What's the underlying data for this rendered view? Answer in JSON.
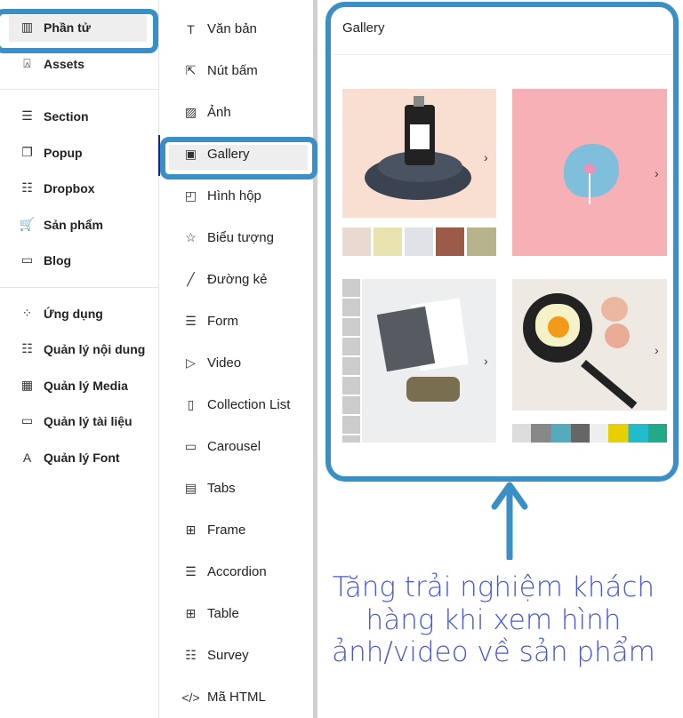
{
  "sidebar": {
    "items": [
      {
        "label": "Phần tử",
        "icon": "elements-icon"
      },
      {
        "label": "Assets",
        "icon": "bookmark-icon"
      },
      {
        "label": "Section",
        "icon": "section-icon"
      },
      {
        "label": "Popup",
        "icon": "popup-icon"
      },
      {
        "label": "Dropbox",
        "icon": "dropbox-icon"
      },
      {
        "label": "Sản phẩm",
        "icon": "cart-icon"
      },
      {
        "label": "Blog",
        "icon": "blog-icon"
      },
      {
        "label": "Ứng dụng",
        "icon": "apps-icon"
      },
      {
        "label": "Quản lý nội dung",
        "icon": "content-icon"
      },
      {
        "label": "Quản lý Media",
        "icon": "media-icon"
      },
      {
        "label": "Quản lý tài liệu",
        "icon": "folder-icon"
      },
      {
        "label": "Quản lý Font",
        "icon": "font-icon"
      }
    ],
    "selected": "Phần tử"
  },
  "elements": {
    "items": [
      {
        "label": "Văn bản",
        "glyph": "T"
      },
      {
        "label": "Nút bấm",
        "glyph": "⇱"
      },
      {
        "label": "Ảnh",
        "glyph": "▨"
      },
      {
        "label": "Gallery",
        "glyph": "▣"
      },
      {
        "label": "Hình hộp",
        "glyph": "◰"
      },
      {
        "label": "Biểu tượng",
        "glyph": "☆"
      },
      {
        "label": "Đường kẻ",
        "glyph": "╱"
      },
      {
        "label": "Form",
        "glyph": "☰"
      },
      {
        "label": "Video",
        "glyph": "▷"
      },
      {
        "label": "Collection List",
        "glyph": "▯"
      },
      {
        "label": "Carousel",
        "glyph": "▭"
      },
      {
        "label": "Tabs",
        "glyph": "▤"
      },
      {
        "label": "Frame",
        "glyph": "⊞"
      },
      {
        "label": "Accordion",
        "glyph": "☰"
      },
      {
        "label": "Table",
        "glyph": "⊞"
      },
      {
        "label": "Survey",
        "glyph": "☷"
      },
      {
        "label": "Mã HTML",
        "glyph": "</>"
      }
    ],
    "selected": "Gallery"
  },
  "preview": {
    "title": "Gallery"
  },
  "annotation": {
    "lines": [
      "Tăng trải nghiệm khách",
      "hàng khi xem hình",
      "ảnh/video về sản phẩm"
    ],
    "color": "#4658d6"
  },
  "colors": {
    "highlight": "#3a8fc4"
  }
}
